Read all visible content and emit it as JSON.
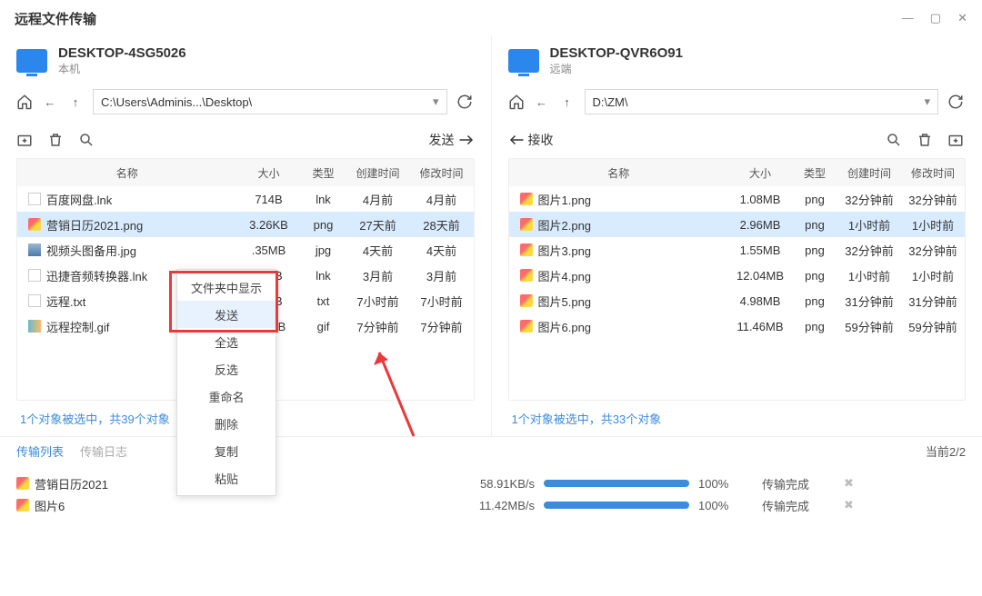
{
  "window": {
    "title": "远程文件传输"
  },
  "left": {
    "hostName": "DESKTOP-4SG5026",
    "hostSub": "本机",
    "path": "C:\\Users\\Adminis...\\Desktop\\",
    "sendLabel": "发送",
    "columns": {
      "name": "名称",
      "size": "大小",
      "type": "类型",
      "ctime": "创建时间",
      "mtime": "修改时间"
    },
    "rows": [
      {
        "icon": "lnk",
        "name": "百度网盘.lnk",
        "size": "714B",
        "type": "lnk",
        "ctime": "4月前",
        "mtime": "4月前"
      },
      {
        "icon": "png",
        "name": "营销日历2021.png",
        "size": "3.26KB",
        "type": "png",
        "ctime": "27天前",
        "mtime": "28天前",
        "selected": true
      },
      {
        "icon": "jpg",
        "name": "视频头图备用.jpg",
        "size": ".35MB",
        "type": "jpg",
        "ctime": "4天前",
        "mtime": "4天前"
      },
      {
        "icon": "lnk",
        "name": "迅捷音频转换器.lnk",
        "size": "714B",
        "type": "lnk",
        "ctime": "3月前",
        "mtime": "3月前"
      },
      {
        "icon": "txt",
        "name": "远程.txt",
        "size": "150B",
        "type": "txt",
        "ctime": "7小时前",
        "mtime": "7小时前"
      },
      {
        "icon": "gif",
        "name": "远程控制.gif",
        "size": ".84MB",
        "type": "gif",
        "ctime": "7分钟前",
        "mtime": "7分钟前"
      }
    ],
    "status": "1个对象被选中，共39个对象"
  },
  "right": {
    "hostName": "DESKTOP-QVR6O91",
    "hostSub": "远端",
    "path": "D:\\ZM\\",
    "recvLabel": "接收",
    "columns": {
      "name": "名称",
      "size": "大小",
      "type": "类型",
      "ctime": "创建时间",
      "mtime": "修改时间"
    },
    "rows": [
      {
        "icon": "png",
        "name": "图片1.png",
        "size": "1.08MB",
        "type": "png",
        "ctime": "32分钟前",
        "mtime": "32分钟前"
      },
      {
        "icon": "png",
        "name": "图片2.png",
        "size": "2.96MB",
        "type": "png",
        "ctime": "1小时前",
        "mtime": "1小时前",
        "selected": true
      },
      {
        "icon": "png",
        "name": "图片3.png",
        "size": "1.55MB",
        "type": "png",
        "ctime": "32分钟前",
        "mtime": "32分钟前"
      },
      {
        "icon": "png",
        "name": "图片4.png",
        "size": "12.04MB",
        "type": "png",
        "ctime": "1小时前",
        "mtime": "1小时前"
      },
      {
        "icon": "png",
        "name": "图片5.png",
        "size": "4.98MB",
        "type": "png",
        "ctime": "31分钟前",
        "mtime": "31分钟前"
      },
      {
        "icon": "png",
        "name": "图片6.png",
        "size": "11.46MB",
        "type": "png",
        "ctime": "59分钟前",
        "mtime": "59分钟前"
      }
    ],
    "status": "1个对象被选中，共33个对象"
  },
  "contextMenu": {
    "items": [
      "文件夹中显示",
      "发送",
      "全选",
      "反选",
      "重命名",
      "删除",
      "复制",
      "粘贴"
    ],
    "highlightIndex": 1
  },
  "bottom": {
    "tabs": {
      "list": "传输列表",
      "log": "传输日志"
    },
    "counter": "当前2/2",
    "transfers": [
      {
        "icon": "png",
        "name": "营销日历2021",
        "speed": "58.91KB/s",
        "pct": "100%",
        "status": "传输完成"
      },
      {
        "icon": "png",
        "name": "图片6",
        "speed": "11.42MB/s",
        "pct": "100%",
        "status": "传输完成"
      }
    ]
  }
}
